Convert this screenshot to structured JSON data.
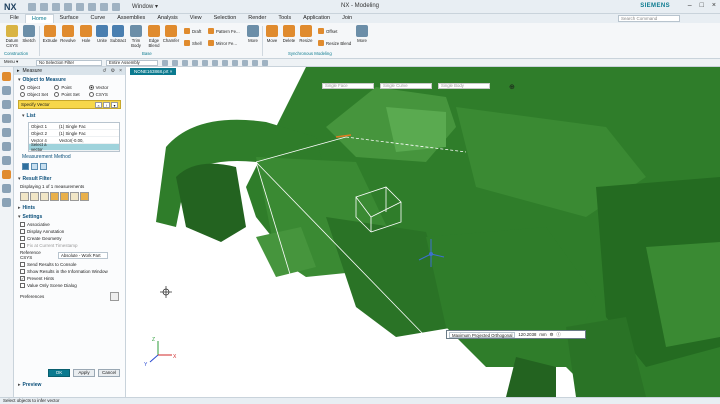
{
  "titlebar": {
    "logo": "NX",
    "window_menu": "Window ▾",
    "title": "NX - Modeling",
    "brand": "SIEMENS"
  },
  "menu": {
    "items": [
      "File",
      "Home",
      "Surface",
      "Curve",
      "Assemblies",
      "Analysis",
      "View",
      "Selection",
      "Render",
      "Tools",
      "Application",
      "Join"
    ],
    "active": "Home",
    "search_placeholder": "Search Command"
  },
  "ribbon": {
    "buttons": [
      "Datum CSYS",
      "Sketch",
      "Extrude",
      "Revolve",
      "Hole",
      "Unite",
      "Subtract",
      "Trim Body",
      "Edge Blend",
      "Chamfer",
      "Move",
      "Delete",
      "Resize",
      "More"
    ],
    "small": [
      "Draft",
      "Shell",
      "Pattern Fe...",
      "Mirror Fe...",
      "Offset",
      "Resize Blend"
    ],
    "more1": "More",
    "more2": "More",
    "groups": [
      "Construction",
      "Base",
      "Synchronous Modeling"
    ]
  },
  "selbar": {
    "menu": "Menu ▾",
    "filter": "No Selection Filter",
    "scope": "Entire Assembly"
  },
  "viewport": {
    "tab": "NONE163868.prt",
    "vp_dd1": "Single Face",
    "vp_dd2": "Single Curve",
    "vp_dd3": "Single Body"
  },
  "panel": {
    "title": "Measure",
    "object_to_measure": "Object to Measure",
    "radios": [
      {
        "label": "Object",
        "on": false
      },
      {
        "label": "Point",
        "on": false
      },
      {
        "label": "Vector",
        "on": true
      },
      {
        "label": "Object Set",
        "on": false
      },
      {
        "label": "Point Set",
        "on": false
      },
      {
        "label": "CSYS",
        "on": false
      }
    ],
    "specify_vector": "Specify Vector",
    "list_label": "List",
    "list": [
      {
        "name": "Object 1",
        "value": "(1) Single Fac"
      },
      {
        "name": "Object 2",
        "value": "(1) Single Fac"
      },
      {
        "name": "Vector 4",
        "value": "Vector(-0.00,"
      },
      {
        "name": "Select a vector",
        "value": ""
      }
    ],
    "measurement_method": "Measurement Method",
    "result_filter": "Result Filter",
    "displaying": "Displaying 1 of 1 measurements",
    "hints": "Hints",
    "settings": "Settings",
    "checks": [
      {
        "label": "Associative",
        "on": false
      },
      {
        "label": "Display Annotation",
        "on": false
      },
      {
        "label": "Create Geometry",
        "on": false
      },
      {
        "label": "Fix at Current Timestamp",
        "on": false
      }
    ],
    "ref_csys_label": "Reference CSYS",
    "ref_csys_value": "Absolute - Work Part",
    "checks2": [
      {
        "label": "Send Results to Console",
        "on": false
      },
      {
        "label": "Show Results in the Information Window",
        "on": false
      },
      {
        "label": "Prevent Hints",
        "on": true
      },
      {
        "label": "Value Only Scene Dialog",
        "on": false
      }
    ],
    "preferences": "Preferences",
    "ok": "OK",
    "apply": "Apply",
    "cancel": "Cancel",
    "preview": "Preview"
  },
  "measure_box": {
    "mode": "Maximum Projected Orthogonal",
    "value": "120.2038",
    "unit": "mm"
  },
  "status": {
    "text": "Select objects to infer vector"
  },
  "colors": {
    "accent": "#0b7a8f",
    "model_green": "#2f7d2a",
    "highlight": "#f7d74a"
  }
}
